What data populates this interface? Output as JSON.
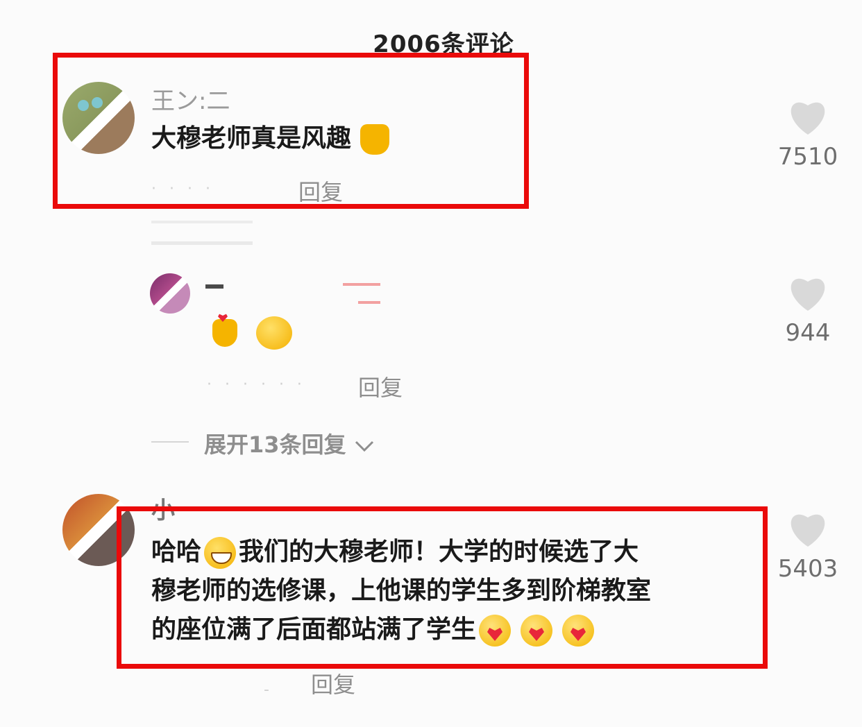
{
  "header": {
    "comment_count_title": "2006条评论"
  },
  "comments": [
    {
      "username": "王ン:二",
      "text": "大穆老师真是风趣",
      "emoji": [
        "thumbs-up"
      ],
      "reply_label": "回复",
      "likes": "7510"
    },
    {
      "username": "",
      "text": "",
      "emoji": [
        "finger-heart",
        "smirk-face"
      ],
      "reply_label": "回复",
      "likes": "944"
    },
    {
      "username": "小",
      "text_lines": [
        "哈哈",
        "我们的大穆老师！大学的时候选了大",
        "穆老师的选修课，上他课的学生多到阶梯教室",
        "的座位满了后面都站满了学生"
      ],
      "emoji": [
        "grin",
        "heart-face",
        "heart-face",
        "heart-face"
      ],
      "reply_label": "回复",
      "likes": "5403"
    }
  ],
  "expand_replies": {
    "label": "展开13条回复"
  },
  "colors": {
    "highlight": "#ea0a0a",
    "like_heart": "#d9d9d9",
    "background": "#fbfbfb"
  }
}
